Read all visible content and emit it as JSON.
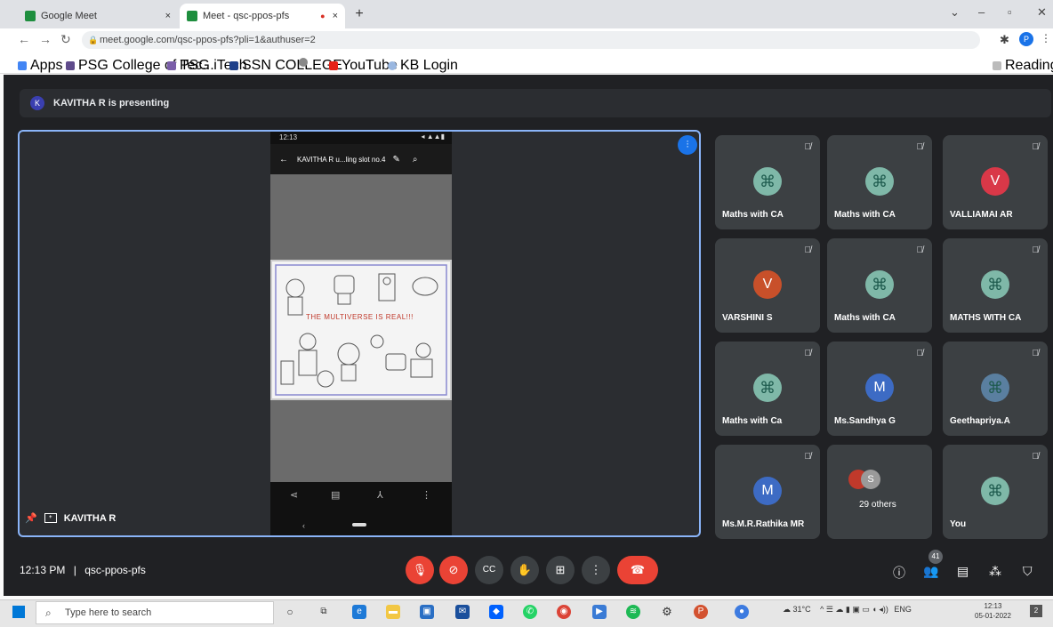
{
  "browser": {
    "tabs": [
      {
        "label": "Google Meet",
        "close": "×"
      },
      {
        "label": "Meet - qsc-ppos-pfs",
        "close": "×"
      }
    ],
    "new_tab": "+",
    "url": "meet.google.com/qsc-ppos-pfs?pli=1&authuser=2",
    "bookmarks": [
      "Apps",
      "PSG College of Tec...",
      "PSG iTech",
      "SSN COLLEGE",
      "YouTube",
      "KB Login"
    ],
    "reading_list": "Reading list"
  },
  "meet": {
    "presenting_banner": "KAVITHA R is presenting",
    "presenter_initial": "K",
    "presenter_name": "KAVITHA R",
    "shared_screen": {
      "status_time": "12:13",
      "doc_title": "KAVITHA R u...ling slot no.4",
      "drawing_text": "THE MULTIVERSE IS REAL!!!"
    },
    "participants": [
      {
        "name": "Maths with CA",
        "initial": "",
        "color": "#7fb8a8"
      },
      {
        "name": "Maths with CA",
        "initial": "",
        "color": "#7fb8a8"
      },
      {
        "name": "VALLIAMAI AR",
        "initial": "V",
        "color": "#d93848"
      },
      {
        "name": "VARSHINI S",
        "initial": "V",
        "color": "#c8502a"
      },
      {
        "name": "Maths with CA",
        "initial": "",
        "color": "#7fb8a8"
      },
      {
        "name": "MATHS WITH CA",
        "initial": "",
        "color": "#7fb8a8"
      },
      {
        "name": "Maths with Ca",
        "initial": "",
        "color": "#7fb8a8"
      },
      {
        "name": "Ms.Sandhya G",
        "initial": "M",
        "color": "#3d6bc4"
      },
      {
        "name": "Geethapriya.A",
        "initial": "",
        "color": "#5a7fa0"
      },
      {
        "name": "Ms.M.R.Rathika MR",
        "initial": "M",
        "color": "#3d6bc4"
      },
      {
        "name": "29 others",
        "initial": "S",
        "color": "#9a9a9a"
      },
      {
        "name": "You",
        "initial": "",
        "color": "#7fb8a8"
      }
    ],
    "time": "12:13 PM",
    "meeting_code": "qsc-ppos-pfs",
    "people_count": "41"
  },
  "taskbar": {
    "search_placeholder": "Type here to search",
    "weather": "31°C",
    "language": "ENG",
    "clock_time": "12:13",
    "clock_date": "05-01-2022",
    "notifications": "2"
  }
}
